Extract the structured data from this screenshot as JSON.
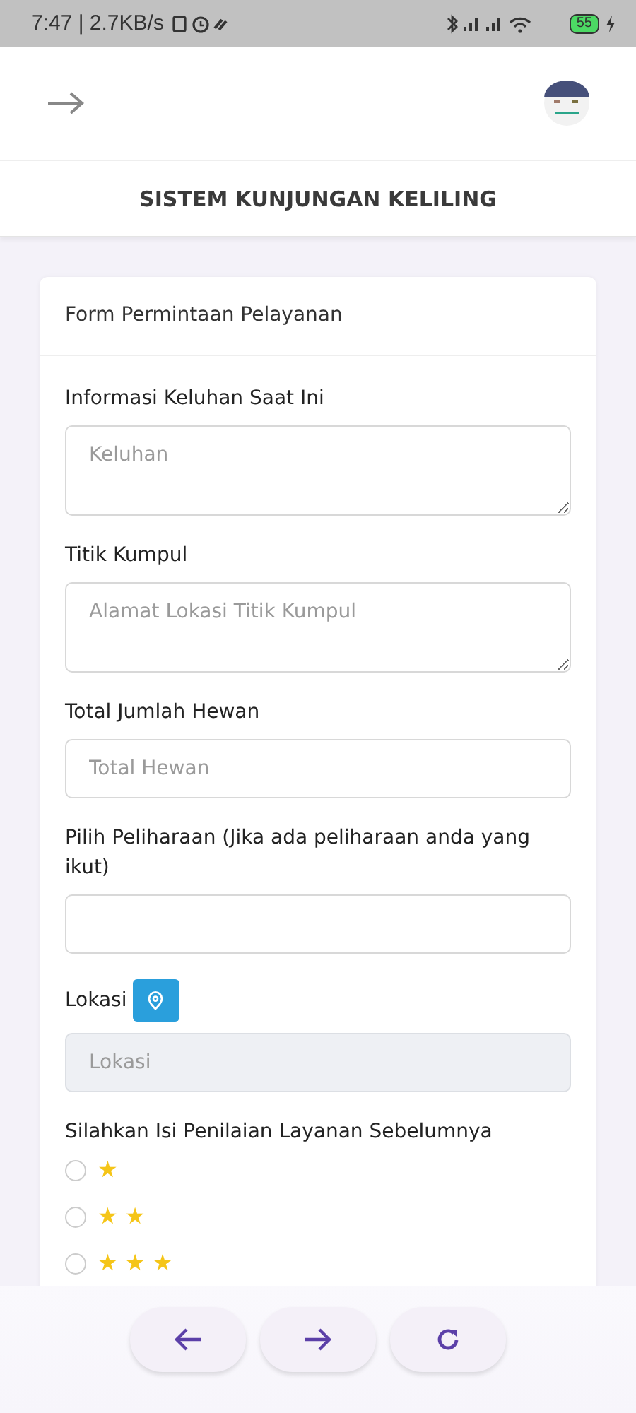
{
  "status_bar": {
    "time": "7:47 | 2.7KB/s",
    "battery": "55"
  },
  "app_title": "SISTEM KUNJUNGAN KELILING",
  "form": {
    "title": "Form Permintaan Pelayanan",
    "fields": [
      {
        "kind": "textarea",
        "label": "Informasi Keluhan Saat Ini",
        "placeholder": "Keluhan",
        "disabled": false
      },
      {
        "kind": "textarea",
        "label": "Titik Kumpul",
        "placeholder": "Alamat Lokasi Titik Kumpul",
        "disabled": false
      },
      {
        "kind": "input",
        "label": "Total Jumlah Hewan",
        "placeholder": "Total Hewan",
        "disabled": false
      },
      {
        "kind": "input",
        "label": "Pilih Peliharaan (Jika ada peliharaan anda yang ikut)",
        "disabled": false
      },
      {
        "kind": "location",
        "label": "Lokasi",
        "placeholder": "Lokasi",
        "disabled": true
      }
    ],
    "rating": {
      "label": "Silahkan Isi Penilaian Layanan Sebelumnya",
      "options": [
        {
          "label": "★",
          "selected": false
        },
        {
          "label": "★ ★",
          "selected": false
        },
        {
          "label": "★ ★ ★",
          "selected": false
        }
      ]
    }
  }
}
